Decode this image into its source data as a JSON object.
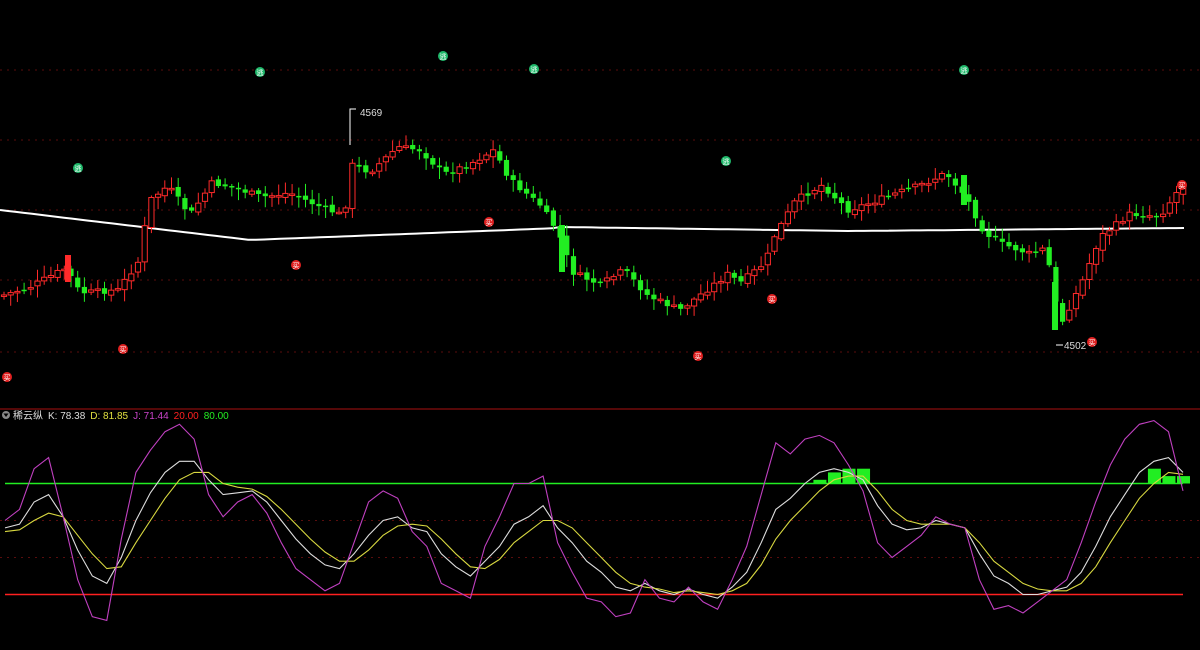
{
  "chart_data": [
    {
      "type": "candlestick",
      "price_labels": {
        "high": "4569",
        "low": "4502"
      },
      "colors": {
        "up": "#ff2a2a",
        "down": "#22ee22",
        "ma_line": "#ffffff",
        "grid": "#5a0d0d"
      },
      "ma_line_name": "",
      "signals": {
        "sell_symbol": "逃",
        "buy_symbol": "买"
      }
    },
    {
      "type": "line",
      "indicator_name": "稀云纵",
      "legend": [
        {
          "key": "K",
          "text": "K: 78.38",
          "color": "#dddddd"
        },
        {
          "key": "D",
          "text": "D: 81.85",
          "color": "#e0e040"
        },
        {
          "key": "J",
          "text": "J: 71.44",
          "color": "#cc44cc"
        },
        {
          "key": "L20",
          "text": "20.00",
          "color": "#ff2020"
        },
        {
          "key": "L80",
          "text": "80.00",
          "color": "#22ee22"
        }
      ],
      "ylim": [
        -10,
        110
      ],
      "levels": [
        20,
        80
      ],
      "series": [
        {
          "key": "K",
          "color": "#dddddd",
          "values": [
            56,
            58,
            70,
            74,
            62,
            44,
            30,
            26,
            40,
            60,
            75,
            86,
            92,
            92,
            82,
            74,
            75,
            76,
            70,
            60,
            50,
            42,
            36,
            34,
            42,
            52,
            60,
            62,
            56,
            54,
            42,
            35,
            30,
            38,
            46,
            58,
            62,
            68,
            56,
            48,
            38,
            32,
            24,
            22,
            26,
            22,
            20,
            23,
            20,
            18,
            24,
            32,
            48,
            66,
            72,
            80,
            86,
            88,
            86,
            82,
            68,
            58,
            55,
            56,
            60,
            58,
            56,
            42,
            30,
            26,
            20,
            20,
            22,
            24,
            32,
            46,
            62,
            74,
            86,
            92,
            94,
            86
          ]
        },
        {
          "key": "D",
          "color": "#d8d840",
          "values": [
            54,
            55,
            60,
            64,
            62,
            52,
            42,
            34,
            35,
            48,
            60,
            72,
            82,
            86,
            86,
            80,
            78,
            77,
            73,
            66,
            58,
            50,
            43,
            38,
            38,
            44,
            52,
            57,
            58,
            57,
            50,
            42,
            35,
            34,
            39,
            48,
            54,
            60,
            60,
            56,
            48,
            40,
            32,
            26,
            24,
            23,
            21,
            22,
            21,
            20,
            22,
            26,
            36,
            50,
            60,
            68,
            76,
            82,
            84,
            84,
            76,
            66,
            60,
            58,
            58,
            58,
            56,
            48,
            38,
            32,
            26,
            23,
            22,
            22,
            26,
            35,
            48,
            60,
            72,
            80,
            86,
            85
          ]
        },
        {
          "key": "J",
          "color": "#c040c0",
          "values": [
            60,
            66,
            88,
            94,
            62,
            28,
            8,
            6,
            50,
            86,
            98,
            108,
            112,
            104,
            74,
            62,
            70,
            74,
            64,
            48,
            34,
            28,
            22,
            26,
            48,
            70,
            76,
            72,
            54,
            46,
            26,
            22,
            18,
            46,
            62,
            80,
            80,
            84,
            48,
            32,
            18,
            16,
            8,
            10,
            28,
            18,
            16,
            24,
            16,
            12,
            28,
            46,
            74,
            102,
            96,
            104,
            106,
            102,
            90,
            76,
            48,
            40,
            46,
            52,
            62,
            58,
            56,
            28,
            12,
            14,
            10,
            16,
            22,
            28,
            48,
            70,
            90,
            104,
            112,
            114,
            108,
            76
          ]
        },
        {
          "key": "BAR",
          "color": "#22ee22",
          "values": [
            0,
            0,
            0,
            0,
            0,
            0,
            0,
            0,
            0,
            0,
            0,
            0,
            0,
            0,
            0,
            0,
            0,
            0,
            0,
            0,
            0,
            0,
            0,
            0,
            0,
            0,
            0,
            0,
            0,
            0,
            0,
            0,
            0,
            0,
            0,
            0,
            0,
            0,
            0,
            0,
            0,
            0,
            0,
            0,
            0,
            0,
            0,
            0,
            0,
            0,
            0,
            0,
            0,
            0,
            0,
            0,
            82,
            86,
            88,
            88,
            0,
            0,
            0,
            0,
            0,
            0,
            0,
            0,
            0,
            0,
            0,
            0,
            0,
            0,
            0,
            0,
            0,
            0,
            0,
            88,
            84,
            84
          ]
        }
      ]
    }
  ]
}
